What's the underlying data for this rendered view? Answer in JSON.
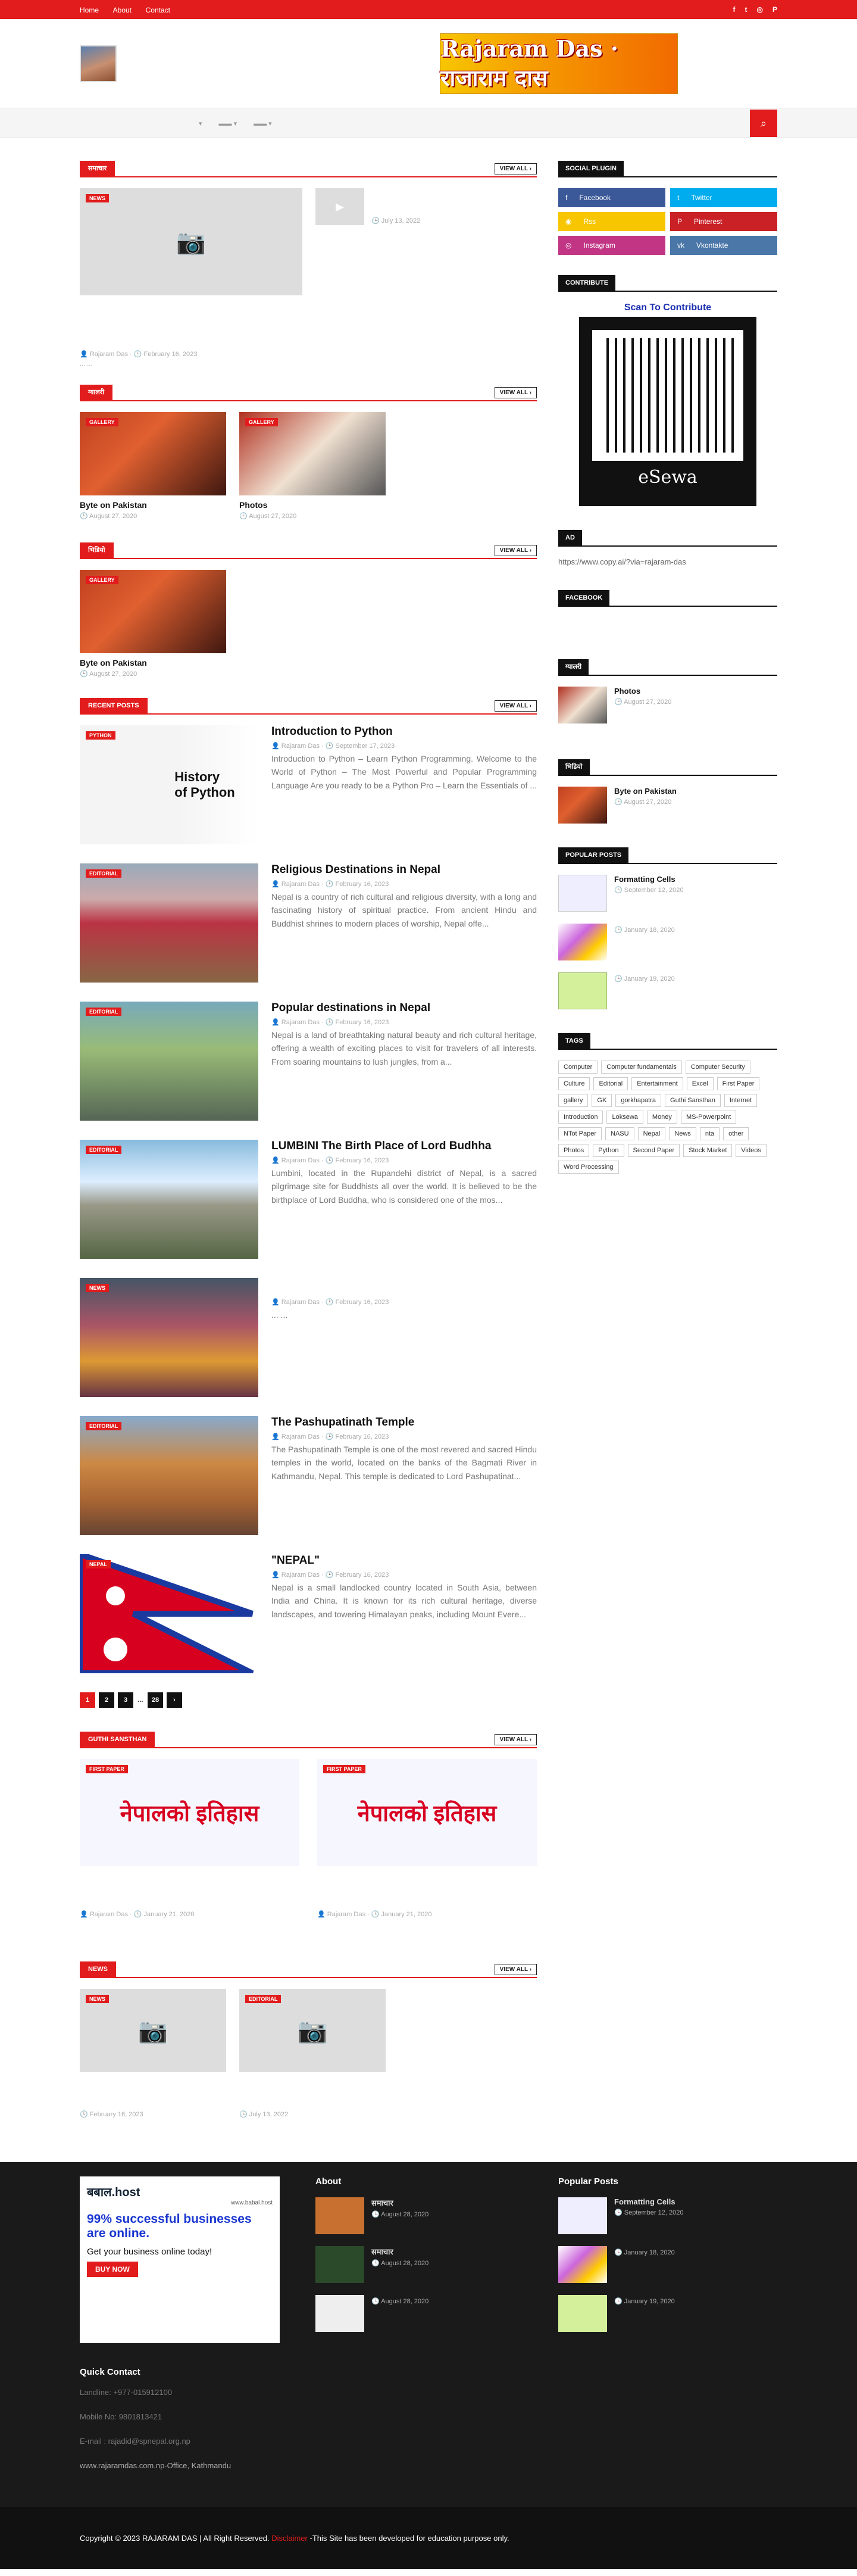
{
  "topbar": {
    "links": [
      "Home",
      "About",
      "Contact"
    ],
    "social_icons": [
      "facebook-icon",
      "twitter-icon",
      "instagram-icon",
      "pinterest-icon"
    ]
  },
  "header": {
    "site_banner": "Rajaram Das · राजाराम दास"
  },
  "nav": {
    "items": [
      "",
      "",
      ""
    ],
    "search_icon": "search-icon"
  },
  "section1": {
    "title": "समाचार",
    "view_all": "VIEW ALL",
    "featured": {
      "badge": "NEWS",
      "title": "",
      "author": "Rajaram Das",
      "date": "February 16, 2023",
      "excerpt": "... ..."
    },
    "side_item": {
      "date": "July 13, 2022"
    }
  },
  "section2": {
    "title": "ग्यालरी",
    "view_all": "VIEW ALL",
    "items": [
      {
        "badge": "GALLERY",
        "title": "Byte on Pakistan",
        "date": "August 27, 2020"
      },
      {
        "badge": "GALLERY",
        "title": "Photos",
        "date": "August 27, 2020"
      }
    ]
  },
  "section3": {
    "title": "भिडियो",
    "view_all": "VIEW ALL",
    "item": {
      "badge": "GALLERY",
      "title": "Byte on Pakistan",
      "date": "August 27, 2020"
    }
  },
  "recent": {
    "title": "RECENT POSTS",
    "view_all": "VIEW ALL",
    "posts": [
      {
        "badge": "PYTHON",
        "title": "Introduction to Python",
        "author": "Rajaram Das",
        "date": "September 17, 2023",
        "excerpt": "Introduction to Python – Learn Python Programming. Welcome to the World of Python – The Most Powerful and Popular Programming Language Are you ready to be a Python Pro – Learn the Essentials of ..."
      },
      {
        "badge": "EDITORIAL",
        "title": "Religious Destinations in Nepal",
        "author": "Rajaram Das",
        "date": "February 16, 2023",
        "excerpt": "Nepal is a country of rich cultural and religious diversity, with a long and fascinating history of spiritual practice. From ancient Hindu and Buddhist shrines to modern places of worship, Nepal offe..."
      },
      {
        "badge": "EDITORIAL",
        "title": "Popular destinations in Nepal",
        "author": "Rajaram Das",
        "date": "February 16, 2023",
        "excerpt": "Nepal is a land of breathtaking natural beauty and rich cultural heritage, offering a wealth of exciting places to visit for travelers of all interests. From soaring mountains to lush jungles, from a..."
      },
      {
        "badge": "EDITORIAL",
        "title": "LUMBINI The Birth Place of Lord Budhha",
        "author": "Rajaram Das",
        "date": "February 16, 2023",
        "excerpt": "Lumbini, located in the Rupandehi district of Nepal, is a sacred pilgrimage site for Buddhists all over the world. It is believed to be the birthplace of Lord Buddha, who is considered one of the mos..."
      },
      {
        "badge": "NEWS",
        "title": "",
        "author": "Rajaram Das",
        "date": "February 16, 2023",
        "excerpt": "... ..."
      },
      {
        "badge": "EDITORIAL",
        "title": "The Pashupatinath Temple",
        "author": "Rajaram Das",
        "date": "February 16, 2023",
        "excerpt": "The Pashupatinath Temple is one of the most revered and sacred Hindu temples in the world, located on the banks of the Bagmati River in Kathmandu, Nepal. This temple is dedicated to Lord Pashupatinat..."
      },
      {
        "badge": "NEPAL",
        "title": "\"NEPAL\"",
        "author": "Rajaram Das",
        "date": "February 16, 2023",
        "excerpt": "Nepal is a small landlocked country located in South Asia, between India and China. It is known for its rich cultural heritage, diverse landscapes, and towering Himalayan peaks, including Mount Evere..."
      }
    ],
    "pager": [
      "1",
      "2",
      "3",
      "...",
      "28",
      "›"
    ]
  },
  "guthi": {
    "title": "GUTHI SANSTHAN",
    "view_all": "VIEW ALL",
    "items": [
      {
        "badge": "FIRST PAPER",
        "img_text": "नेपालको इतिहास",
        "author": "Rajaram Das",
        "date": "January 21, 2020"
      },
      {
        "badge": "FIRST PAPER",
        "img_text": "नेपालको इतिहास",
        "author": "Rajaram Das",
        "date": "January 21, 2020"
      }
    ]
  },
  "news2": {
    "title": "NEWS",
    "view_all": "VIEW ALL",
    "items": [
      {
        "badge": "NEWS",
        "date": "February 16, 2023"
      },
      {
        "badge": "EDITORIAL",
        "date": "July 13, 2022"
      }
    ]
  },
  "sidebar": {
    "social_title": "SOCIAL PLUGIN",
    "social": [
      {
        "label": "Facebook",
        "color": "#3b5999"
      },
      {
        "label": "Twitter",
        "color": "#00acee"
      },
      {
        "label": "Rss",
        "color": "#f7c600"
      },
      {
        "label": "Pinterest",
        "color": "#ca2127"
      },
      {
        "label": "Instagram",
        "color": "#c13584"
      },
      {
        "label": "Vkontakte",
        "color": "#4a76a8"
      }
    ],
    "contribute_title": "CONTRIBUTE",
    "contribute_text": "Scan To Contribute",
    "esewa": "eSewa",
    "ad_title": "AD",
    "ad_link": "https://www.copy.ai/?via=rajaram-das",
    "facebook_title": "FACEBOOK",
    "gallery_title": "ग्यालरी",
    "gallery": [
      {
        "title": "Photos",
        "date": "August 27, 2020"
      }
    ],
    "video_title": "भिडियो",
    "video": [
      {
        "title": "Byte on Pakistan",
        "date": "August 27, 2020"
      }
    ],
    "popular_title": "POPULAR POSTS",
    "popular": [
      {
        "title": "Formatting Cells",
        "date": "September 12, 2020"
      },
      {
        "title": "",
        "date": "January 18, 2020"
      },
      {
        "title": "",
        "date": "January 19, 2020"
      }
    ],
    "tags_title": "TAGS",
    "tags": [
      "Computer",
      "Computer fundamentals",
      "Computer Security",
      "Culture",
      "Editorial",
      "Entertainment",
      "Excel",
      "First Paper",
      "gallery",
      "GK",
      "gorkhapatra",
      "Guthi Sansthan",
      "Internet",
      "Introduction",
      "Loksewa",
      "Money",
      "MS-Powerpoint",
      "NTot Paper",
      "NASU",
      "Nepal",
      "News",
      "nta",
      "other",
      "Photos",
      "Python",
      "Second Paper",
      "Stock Market",
      "Videos",
      "Word Processing"
    ]
  },
  "footer": {
    "ad": {
      "brand": "बबाल.host",
      "url": "www.babal.host",
      "headline": "99% successful businesses are online.",
      "sub": "Get your business online today!",
      "cta": "BUY NOW"
    },
    "about_title": "About",
    "about_items": [
      {
        "title": "समाचार",
        "date": "August 28, 2020"
      },
      {
        "title": "समाचार",
        "date": "August 28, 2020"
      },
      {
        "title": "",
        "date": "August 28, 2020"
      }
    ],
    "popular_title": "Popular Posts",
    "popular": [
      {
        "title": "Formatting Cells",
        "date": "September 12, 2020"
      },
      {
        "title": "",
        "date": "January 18, 2020"
      },
      {
        "title": "",
        "date": "January 19, 2020"
      }
    ],
    "contact_title": "Quick Contact",
    "contact": [
      "Landline: +977-015912100",
      "Mobile No: 9801813421",
      "E-mail : rajadid@spnepal.org.np",
      "www.rajaramdas.com.np-Office, Kathmandu"
    ],
    "copyright": "Copyright © 2023 RAJARAM DAS | All Right Reserved.",
    "disclaimer": "Disclaimer",
    "note": "-This Site has been developed for education purpose only."
  }
}
